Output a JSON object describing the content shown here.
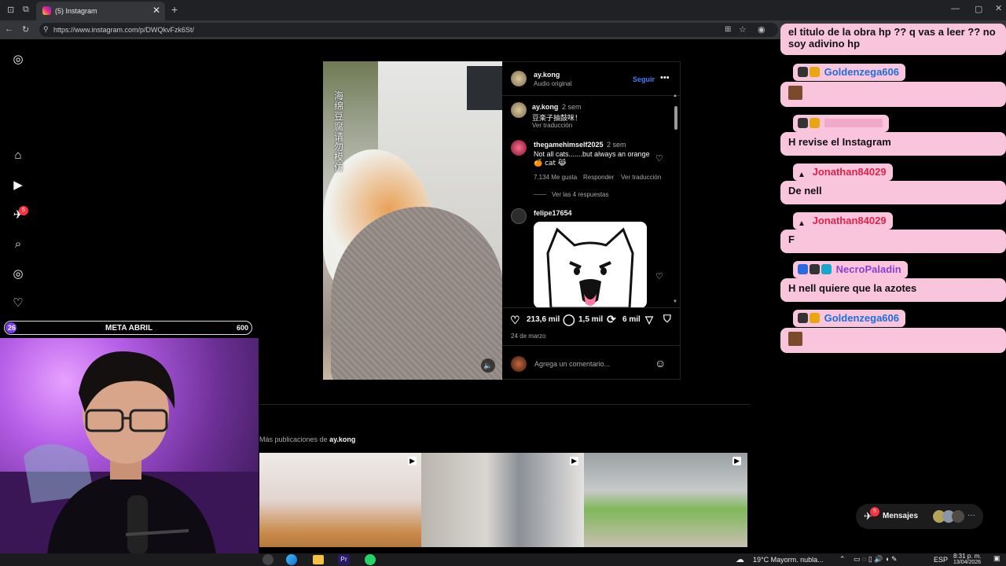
{
  "browser": {
    "tab_title": "(5) Instagram",
    "url": "https://www.instagram.com/p/DWQkvFzk6St/"
  },
  "post": {
    "author": "ay.kong",
    "audio": "Audio original",
    "follow_label": "Seguir",
    "watermark": "海绵豆腐请勿模仿",
    "caption": {
      "user": "ay.kong",
      "time": "2 sem",
      "text": "豆楽子抽鼓咪！",
      "translate": "Ver traducción"
    },
    "comments": [
      {
        "user": "thegamehimself2025",
        "time": "2 sem",
        "text_line1": "Not all cats.......but always an orange",
        "text_line2": "🍊 cat 😹",
        "likes": "7.134 Me gusta",
        "reply": "Responder",
        "translate": "Ver traducción",
        "replies": "Ver las 4 respuestas"
      },
      {
        "user": "felipe17654"
      }
    ],
    "stats": {
      "likes": "213,6 mil",
      "comments": "1,5 mil",
      "reposts": "6 mil"
    },
    "date": "24 de marzo",
    "comment_placeholder": "Agrega un comentario..."
  },
  "more_posts": {
    "label_prefix": "Más publicaciones de",
    "label_user": "ay.kong"
  },
  "nav": {
    "notif_count": "5"
  },
  "chat": {
    "top_text_line1": "el titulo de la obra hp ?? q vas a leer ?? no",
    "top_text_line2": "soy adivino hp",
    "messages": [
      {
        "user": "Goldenzega606",
        "text": ""
      },
      {
        "user": "",
        "text": "H revise el Instagram"
      },
      {
        "user": "Jonathan84029",
        "text": "De nell"
      },
      {
        "user": "Jonathan84029",
        "text": "F"
      },
      {
        "user": "NecroPaladin",
        "text": "H nell quiere que la azotes"
      },
      {
        "user": "Goldenzega606",
        "text": ""
      }
    ]
  },
  "stream": {
    "meta_label": "META ABRIL",
    "meta_current": "26",
    "meta_goal": "600",
    "meta_progress": 0.043
  },
  "messages_pill": {
    "label": "Mensajes",
    "count": "5"
  },
  "taskbar": {
    "weather": "19°C  Mayorm. nubla...",
    "lang": "ESP",
    "time": "8:31 p. m.",
    "date": "13/04/2026"
  },
  "colors": {
    "chat_bubble": "#f9c5dd",
    "chat_name_blue": "#1e6fd9",
    "chat_name_red": "#e0224b",
    "chat_name_purple": "#8b3fd1",
    "link_blue": "#4a7aff"
  }
}
